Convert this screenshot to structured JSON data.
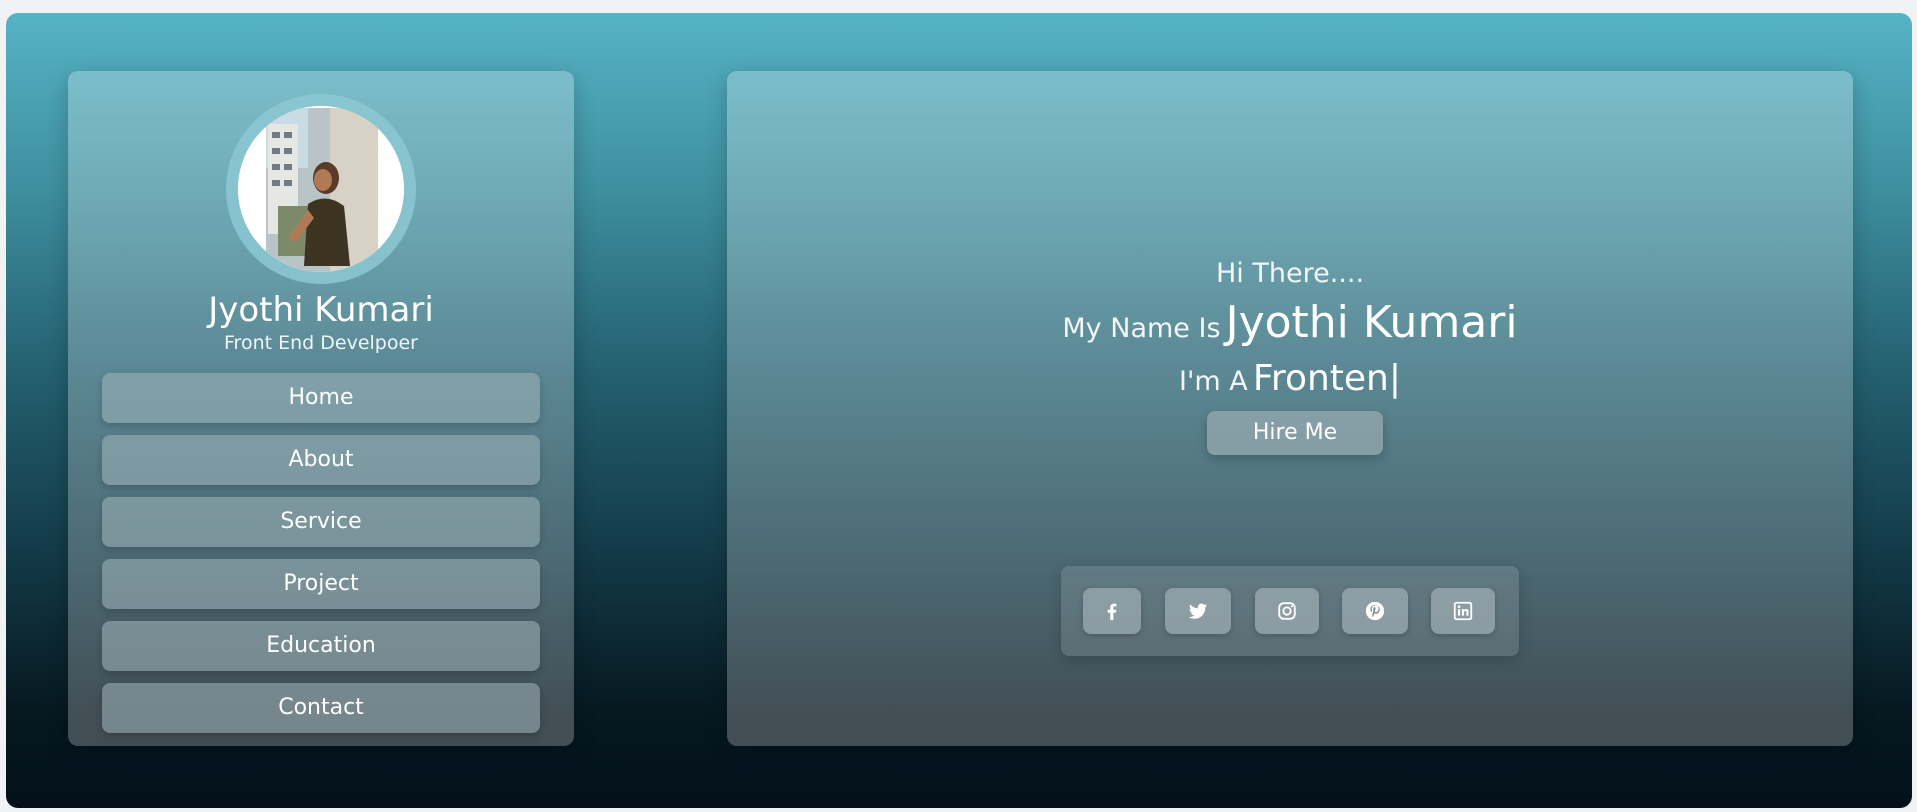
{
  "sidebar": {
    "avatar_alt": "profile photo",
    "name": "Jyothi Kumari",
    "role": "Front End Develpoer",
    "nav": [
      {
        "label": "Home"
      },
      {
        "label": "About"
      },
      {
        "label": "Service"
      },
      {
        "label": "Project"
      },
      {
        "label": "Education"
      },
      {
        "label": "Contact"
      }
    ]
  },
  "hero": {
    "greeting": "Hi There....",
    "name_prefix": "My Name Is",
    "name": "Jyothi Kumari",
    "role_prefix": "I'm A",
    "typed_text": "Fronten|",
    "hire_label": "Hire Me"
  },
  "social": [
    {
      "icon": "facebook-icon"
    },
    {
      "icon": "twitter-icon"
    },
    {
      "icon": "instagram-icon"
    },
    {
      "icon": "pinterest-icon"
    },
    {
      "icon": "linkedin-icon"
    }
  ],
  "colors": {
    "gradient_top": "#55b3c5",
    "gradient_bottom": "#03101a",
    "text": "#ffffff"
  }
}
